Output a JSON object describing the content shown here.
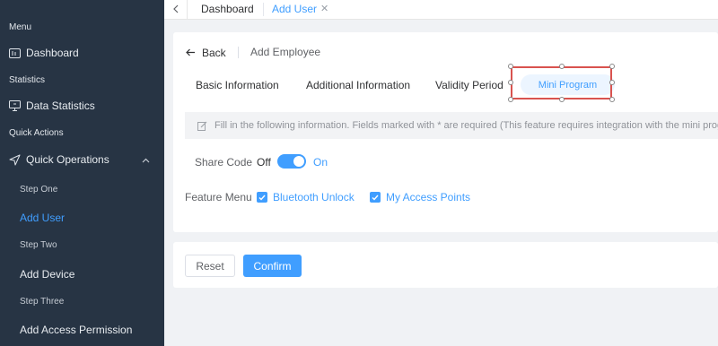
{
  "sidebar": {
    "menu_heading": "Menu",
    "dashboard": "Dashboard",
    "statistics_heading": "Statistics",
    "data_statistics": "Data Statistics",
    "quick_actions_heading": "Quick Actions",
    "quick_operations": "Quick Operations",
    "step_one": "Step One",
    "add_user": "Add User",
    "step_two": "Step Two",
    "add_device": "Add Device",
    "step_three": "Step Three",
    "add_access_permission": "Add Access Permission"
  },
  "tabs": {
    "dashboard": "Dashboard",
    "add_user": "Add User",
    "close_glyph": "✕"
  },
  "main": {
    "back_label": "Back",
    "page_title": "Add Employee",
    "section_tabs": [
      "Basic Information",
      "Additional Information",
      "Validity Period",
      "Mini Program"
    ],
    "info_text": "Fill in the following information. Fields marked with * are required (This feature requires integration with the mini program)",
    "share_code_label": "Share Code",
    "off_label": "Off",
    "on_label": "On",
    "share_code_enabled": true,
    "feature_menu_label": "Feature Menu",
    "features": [
      {
        "label": "Bluetooth Unlock",
        "checked": true
      },
      {
        "label": "My Access Points",
        "checked": true
      }
    ]
  },
  "footer": {
    "reset_label": "Reset",
    "confirm_label": "Confirm"
  },
  "colors": {
    "sidebar_bg": "#273444",
    "accent": "#409eff",
    "highlight_border": "#d9534f"
  }
}
